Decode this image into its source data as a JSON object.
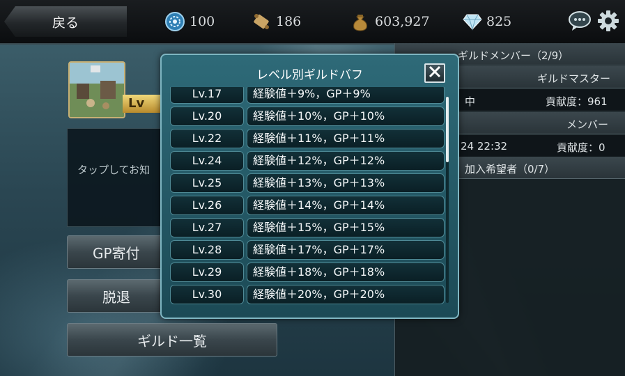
{
  "header": {
    "back_label": "戻る",
    "resources": [
      {
        "icon": "crystal-orb-icon",
        "value": "100"
      },
      {
        "icon": "scroll-icon",
        "value": "186"
      },
      {
        "icon": "money-bag-icon",
        "value": "603,927"
      },
      {
        "icon": "diamond-icon",
        "value": "825"
      }
    ],
    "chat_icon": "speech-bubble-icon",
    "settings_icon": "gear-icon"
  },
  "guild": {
    "level_prefix": "Lv",
    "notice_placeholder": "タップしてお知"
  },
  "left_buttons": {
    "donate": "GP寄付",
    "leave": "脱退",
    "guild_list": "ギルド一覧"
  },
  "right_panel": {
    "members_header": "ギルドメンバー（2/9）",
    "master_role": "ギルドマスター",
    "master_status": "中",
    "master_contribution": "貢献度：961",
    "member_role": "メンバー",
    "member_time": "24 22:32",
    "member_contribution": "貢献度：0",
    "applicants_header": "加入希望者（0/7）"
  },
  "modal": {
    "title": "レベル別ギルドバフ",
    "rows": [
      {
        "level": "Lv.17",
        "buff": "経験値＋9%，GP＋9%"
      },
      {
        "level": "Lv.20",
        "buff": "経験値＋10%，GP＋10%"
      },
      {
        "level": "Lv.22",
        "buff": "経験値＋11%，GP＋11%"
      },
      {
        "level": "Lv.24",
        "buff": "経験値＋12%，GP＋12%"
      },
      {
        "level": "Lv.25",
        "buff": "経験値＋13%，GP＋13%"
      },
      {
        "level": "Lv.26",
        "buff": "経験値＋14%，GP＋14%"
      },
      {
        "level": "Lv.27",
        "buff": "経験値＋15%，GP＋15%"
      },
      {
        "level": "Lv.28",
        "buff": "経験値＋17%，GP＋17%"
      },
      {
        "level": "Lv.29",
        "buff": "経験値＋18%，GP＋18%"
      },
      {
        "level": "Lv.30",
        "buff": "経験値＋20%，GP＋20%"
      }
    ]
  },
  "colors": {
    "modal_border": "#7fb6c2",
    "row_border": "#4f8a96",
    "gold": "#c7b074"
  }
}
